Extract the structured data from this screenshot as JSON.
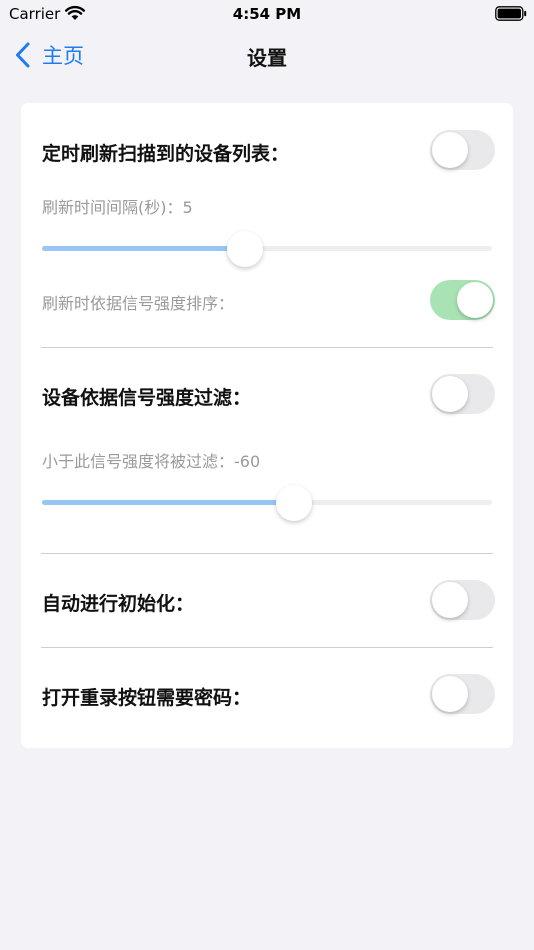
{
  "status_bar": {
    "carrier": "Carrier",
    "time": "4:54 PM",
    "wifi_icon": "wifi-icon",
    "battery_icon": "battery-icon"
  },
  "nav": {
    "back_label": "主页",
    "title": "设置",
    "accent_color": "#1e7cf2"
  },
  "settings": {
    "refresh_list": {
      "label": "定时刷新扫描到的设备列表：",
      "enabled": false
    },
    "refresh_interval": {
      "label": "刷新时间间隔(秒)：5",
      "slider_fraction": 0.45
    },
    "sort_by_signal": {
      "label": "刷新时依据信号强度排序：",
      "enabled": true
    },
    "filter_by_signal": {
      "label": "设备依据信号强度过滤：",
      "enabled": false
    },
    "filter_threshold": {
      "label": "小于此信号强度将被过滤：-60",
      "slider_fraction": 0.56
    },
    "auto_init": {
      "label": "自动进行初始化：",
      "enabled": false
    },
    "rerecord_password": {
      "label": "打开重录按钮需要密码：",
      "enabled": false
    }
  },
  "colors": {
    "switch_on": "#a9e3b3",
    "switch_off": "#e9e9eb",
    "slider_fill": "#99c5f5"
  }
}
